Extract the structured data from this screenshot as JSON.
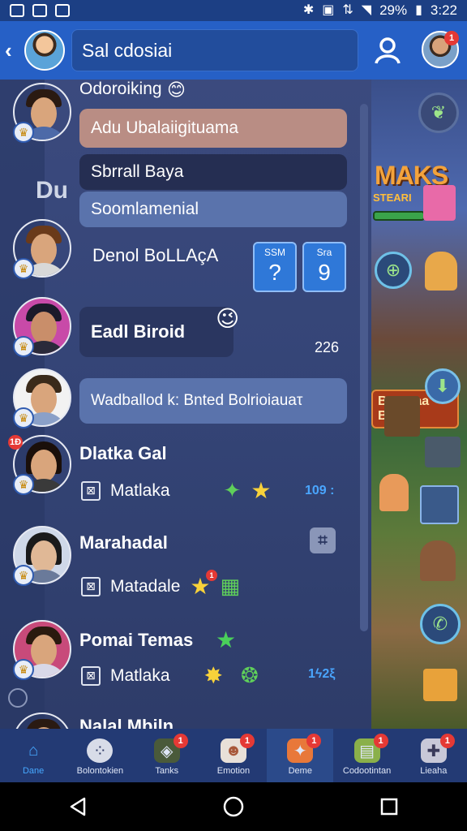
{
  "statusbar": {
    "battery": "29%",
    "time": "3:22"
  },
  "header": {
    "search_value": "Sal cdosiai",
    "notifications": "1"
  },
  "game": {
    "title": "MAKS",
    "subtitle": "STEARI",
    "banner_line1": "Boomaa",
    "banner_line2": "Bo"
  },
  "list": {
    "r1": {
      "name": "Odoroiking",
      "b1": "Adu Ubalaiigituama",
      "b2": "Sbrrall Baya",
      "b3": "Soomlamenial"
    },
    "side_label": "Du",
    "r2": {
      "name": "Denol BoLLAçA",
      "t1_label": "SSM",
      "t1_value": "?",
      "t2_label": "Sra",
      "t2_value": "9"
    },
    "r3": {
      "name": "Eadl Biroid",
      "count": "226"
    },
    "r4": {
      "text": "Wadballod k: Bnted Bolrioiauaτ"
    },
    "r5": {
      "name": "Dlatka Gal",
      "sub": "Matlaka",
      "score": "109 :",
      "badge": "1Ð"
    },
    "r6": {
      "name": "Marahadal",
      "sub": "Matadale",
      "badge": "1"
    },
    "r7": {
      "name": "Pomai Temas",
      "sub": "Matlaka",
      "score": "1ϟ2ξ"
    },
    "r8": {
      "name": "Nalal Mbiln"
    }
  },
  "nav": [
    {
      "label": "Dane",
      "icon": "home-icon",
      "badge": ""
    },
    {
      "label": "Bolontokien",
      "icon": "dots-icon",
      "badge": ""
    },
    {
      "label": "Tanks",
      "icon": "tank-icon",
      "badge": "1"
    },
    {
      "label": "Emotion",
      "icon": "emoji-icon",
      "badge": "1"
    },
    {
      "label": "Deme",
      "icon": "game-icon",
      "badge": "1"
    },
    {
      "label": "Codootintan",
      "icon": "chest-icon",
      "badge": "1"
    },
    {
      "label": "Lieaha",
      "icon": "controller-icon",
      "badge": "1"
    }
  ],
  "colors": {
    "header": "#2660c6",
    "panel": "#344476",
    "accent": "#46a8ff"
  }
}
